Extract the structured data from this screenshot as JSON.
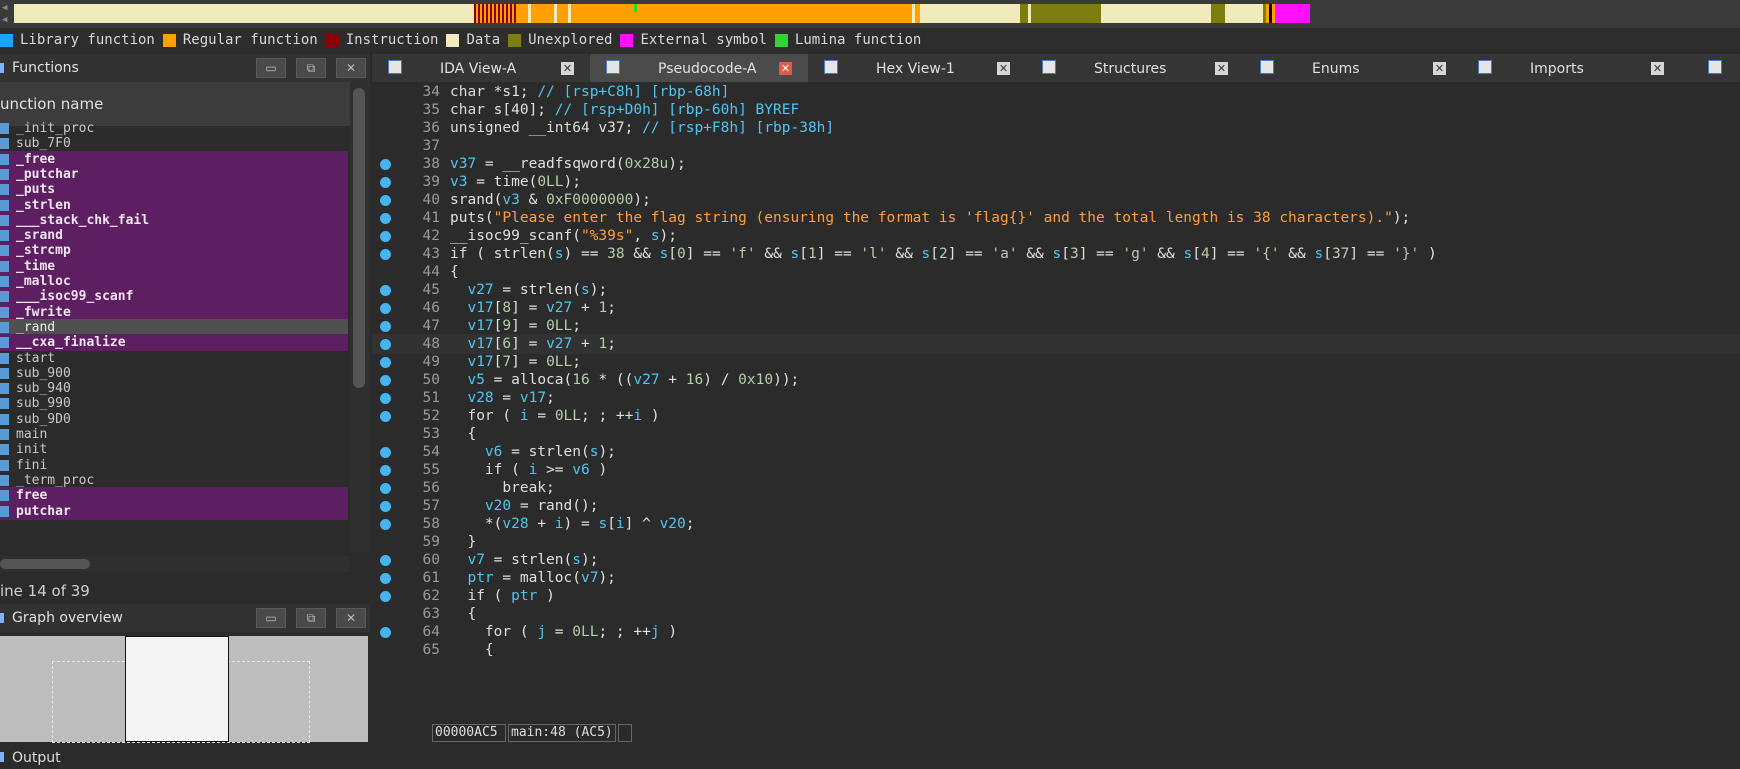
{
  "legend": [
    {
      "label": "Library function",
      "color": "#1aa3ff"
    },
    {
      "label": "Regular function",
      "color": "#ffa000"
    },
    {
      "label": "Instruction",
      "color": "#8b0000"
    },
    {
      "label": "Data",
      "color": "#f0eabc"
    },
    {
      "label": "Unexplored",
      "color": "#7d7d10"
    },
    {
      "label": "External symbol",
      "color": "#ff10ff"
    },
    {
      "label": "Lumina function",
      "color": "#2ed62e"
    }
  ],
  "functions_panel": {
    "title": "Functions",
    "column_header": "unction name",
    "line_info": "ine 14 of 39",
    "items": [
      {
        "name": "_init_proc",
        "style": "normal"
      },
      {
        "name": "sub_7F0",
        "style": "normal"
      },
      {
        "name": "_free",
        "style": "lib"
      },
      {
        "name": "_putchar",
        "style": "lib"
      },
      {
        "name": "_puts",
        "style": "lib"
      },
      {
        "name": "_strlen",
        "style": "lib"
      },
      {
        "name": "___stack_chk_fail",
        "style": "lib"
      },
      {
        "name": "_srand",
        "style": "lib"
      },
      {
        "name": "_strcmp",
        "style": "lib"
      },
      {
        "name": "_time",
        "style": "lib"
      },
      {
        "name": "_malloc",
        "style": "lib"
      },
      {
        "name": "___isoc99_scanf",
        "style": "lib"
      },
      {
        "name": "_fwrite",
        "style": "lib"
      },
      {
        "name": "_rand",
        "style": "sel"
      },
      {
        "name": "__cxa_finalize",
        "style": "lib"
      },
      {
        "name": "start",
        "style": "normal"
      },
      {
        "name": "sub_900",
        "style": "normal"
      },
      {
        "name": "sub_940",
        "style": "normal"
      },
      {
        "name": "sub_990",
        "style": "normal"
      },
      {
        "name": "sub_9D0",
        "style": "normal"
      },
      {
        "name": "main",
        "style": "normal"
      },
      {
        "name": "init",
        "style": "normal"
      },
      {
        "name": "fini",
        "style": "normal"
      },
      {
        "name": "_term_proc",
        "style": "normal"
      },
      {
        "name": "free",
        "style": "lib"
      },
      {
        "name": "putchar",
        "style": "lib"
      }
    ]
  },
  "graph_panel": {
    "title": "Graph overview"
  },
  "output_panel": {
    "title": "Output"
  },
  "tabs": [
    {
      "label": "IDA View-A",
      "active": false
    },
    {
      "label": "Pseudocode-A",
      "active": true
    },
    {
      "label": "Hex View-1",
      "active": false
    },
    {
      "label": "Structures",
      "active": false
    },
    {
      "label": "Enums",
      "active": false
    },
    {
      "label": "Imports",
      "active": false
    }
  ],
  "code_lines": [
    {
      "n": "34",
      "bp": false,
      "html": "<span class='kw'>char</span> *s1; <span class='cm'>// [rsp+C8h] [rbp-68h]</span>"
    },
    {
      "n": "35",
      "bp": false,
      "html": "<span class='kw'>char</span> s[40]; <span class='cm'>// [rsp+D0h] [rbp-60h] BYREF</span>"
    },
    {
      "n": "36",
      "bp": false,
      "html": "<span class='kw'>unsigned __int64</span> v37; <span class='cm'>// [rsp+F8h] [rbp-38h]</span>"
    },
    {
      "n": "37",
      "bp": false,
      "html": ""
    },
    {
      "n": "38",
      "bp": true,
      "html": "<span class='var'>v37</span> = __readfsqword(<span class='num'>0x28u</span>);"
    },
    {
      "n": "39",
      "bp": true,
      "html": "<span class='var'>v3</span> = time(<span class='num'>0LL</span>);"
    },
    {
      "n": "40",
      "bp": true,
      "html": "srand(<span class='var'>v3</span> &amp; <span class='num'>0xF0000000</span>);"
    },
    {
      "n": "41",
      "bp": true,
      "html": "puts(<span class='str'>\"Please enter the flag string (ensuring the format is 'flag{}' and the total length is 38 characters).\"</span>);"
    },
    {
      "n": "42",
      "bp": true,
      "html": "__isoc99_scanf(<span class='str'>\"%39s\"</span>, <span class='var'>s</span>);"
    },
    {
      "n": "43",
      "bp": true,
      "html": "<span class='kw'>if</span> ( strlen(<span class='var'>s</span>) == <span class='num'>38</span> &amp;&amp; <span class='var'>s</span>[<span class='num'>0</span>] == <span class='num'>'f'</span> &amp;&amp; <span class='var'>s</span>[<span class='num'>1</span>] == <span class='num'>'l'</span> &amp;&amp; <span class='var'>s</span>[<span class='num'>2</span>] == <span class='num'>'a'</span> &amp;&amp; <span class='var'>s</span>[<span class='num'>3</span>] == <span class='num'>'g'</span> &amp;&amp; <span class='var'>s</span>[<span class='num'>4</span>] == <span class='num'>'{'</span> &amp;&amp; <span class='var'>s</span>[<span class='num'>37</span>] == <span class='num'>'}'</span> )"
    },
    {
      "n": "44",
      "bp": false,
      "html": "{"
    },
    {
      "n": "45",
      "bp": true,
      "html": "  <span class='var'>v27</span> = strlen(<span class='var'>s</span>);"
    },
    {
      "n": "46",
      "bp": true,
      "html": "  <span class='var'>v17</span>[<span class='num'>8</span>] = <span class='var'>v27</span> + <span class='num'>1</span>;"
    },
    {
      "n": "47",
      "bp": true,
      "html": "  <span class='var'>v17</span>[<span class='num'>9</span>] = <span class='num'>0LL</span>;"
    },
    {
      "n": "48",
      "bp": true,
      "cur": true,
      "html": "  <span class='var'>v17</span>[<span class='num'>6</span>] = <span class='var'>v27</span> + <span class='num'>1</span>;"
    },
    {
      "n": "49",
      "bp": true,
      "html": "  <span class='var'>v17</span>[<span class='num'>7</span>] = <span class='num'>0LL</span>;"
    },
    {
      "n": "50",
      "bp": true,
      "html": "  <span class='var'>v5</span> = alloca(<span class='num'>16</span> * ((<span class='var'>v27</span> + <span class='num'>16</span>) / <span class='num'>0x10</span>));"
    },
    {
      "n": "51",
      "bp": true,
      "html": "  <span class='var'>v28</span> = <span class='var'>v17</span>;"
    },
    {
      "n": "52",
      "bp": true,
      "html": "  <span class='kw'>for</span> ( <span class='var'>i</span> = <span class='num'>0LL</span>; ; ++<span class='var'>i</span> )"
    },
    {
      "n": "53",
      "bp": false,
      "html": "  {"
    },
    {
      "n": "54",
      "bp": true,
      "html": "    <span class='var'>v6</span> = strlen(<span class='var'>s</span>);"
    },
    {
      "n": "55",
      "bp": true,
      "html": "    <span class='kw'>if</span> ( <span class='var'>i</span> &gt;= <span class='var'>v6</span> )"
    },
    {
      "n": "56",
      "bp": true,
      "html": "      <span class='kw'>break</span>;"
    },
    {
      "n": "57",
      "bp": true,
      "html": "    <span class='var'>v20</span> = rand();"
    },
    {
      "n": "58",
      "bp": true,
      "html": "    *(<span class='var'>v28</span> + <span class='var'>i</span>) = <span class='var'>s</span>[<span class='var'>i</span>] ^ <span class='var'>v20</span>;"
    },
    {
      "n": "59",
      "bp": false,
      "html": "  }"
    },
    {
      "n": "60",
      "bp": true,
      "html": "  <span class='var'>v7</span> = strlen(<span class='var'>s</span>);"
    },
    {
      "n": "61",
      "bp": true,
      "html": "  <span class='var'>ptr</span> = malloc(<span class='var'>v7</span>);"
    },
    {
      "n": "62",
      "bp": true,
      "html": "  <span class='kw'>if</span> ( <span class='var'>ptr</span> )"
    },
    {
      "n": "63",
      "bp": false,
      "html": "  {"
    },
    {
      "n": "64",
      "bp": true,
      "html": "    <span class='kw'>for</span> ( <span class='var'>j</span> = <span class='num'>0LL</span>; ; ++<span class='var'>j</span> )"
    },
    {
      "n": "65",
      "bp": false,
      "html": "    {"
    }
  ],
  "status": {
    "address": "00000AC5",
    "location": "main:48 (AC5)"
  }
}
